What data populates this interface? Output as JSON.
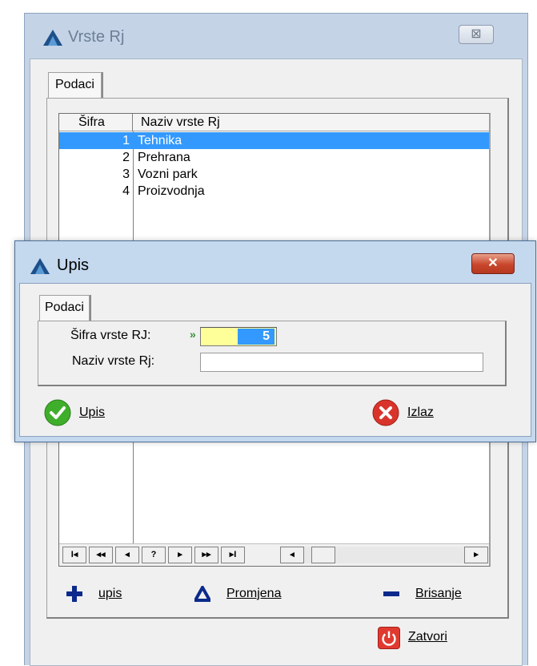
{
  "back_window": {
    "title": "Vrste Rj",
    "close_glyph": "⊠",
    "tab_label": "Podaci",
    "grid": {
      "columns": [
        "Šifra",
        "Naziv vrste Rj"
      ],
      "rows": [
        {
          "sifra": "1",
          "naziv": "Tehnika",
          "selected": true
        },
        {
          "sifra": "2",
          "naziv": "Prehrana",
          "selected": false
        },
        {
          "sifra": "3",
          "naziv": "Vozni park",
          "selected": false
        },
        {
          "sifra": "4",
          "naziv": "Proizvodnja",
          "selected": false
        }
      ],
      "nav_buttons": [
        "I◂",
        "◂◂",
        "◂",
        "?",
        "▸",
        "▸▸",
        "▸I"
      ]
    },
    "actions": {
      "upis": "upis",
      "promjena": "Promjena",
      "brisanje": "Brisanje",
      "zatvori": "Zatvori"
    }
  },
  "dialog": {
    "title": "Upis",
    "close_glyph": "✕",
    "tab_label": "Podaci",
    "sifra_label": "Šifra vrste RJ:",
    "sifra_marker": "»",
    "sifra_value": "5",
    "naziv_label": "Naziv vrste Rj:",
    "naziv_value": "",
    "upis_button": "Upis",
    "izlaz_button": "Izlaz"
  },
  "colors": {
    "selection": "#3399ff",
    "required_field": "#ffff99",
    "ok_green": "#3fae2a",
    "cancel_red": "#d9342b"
  }
}
